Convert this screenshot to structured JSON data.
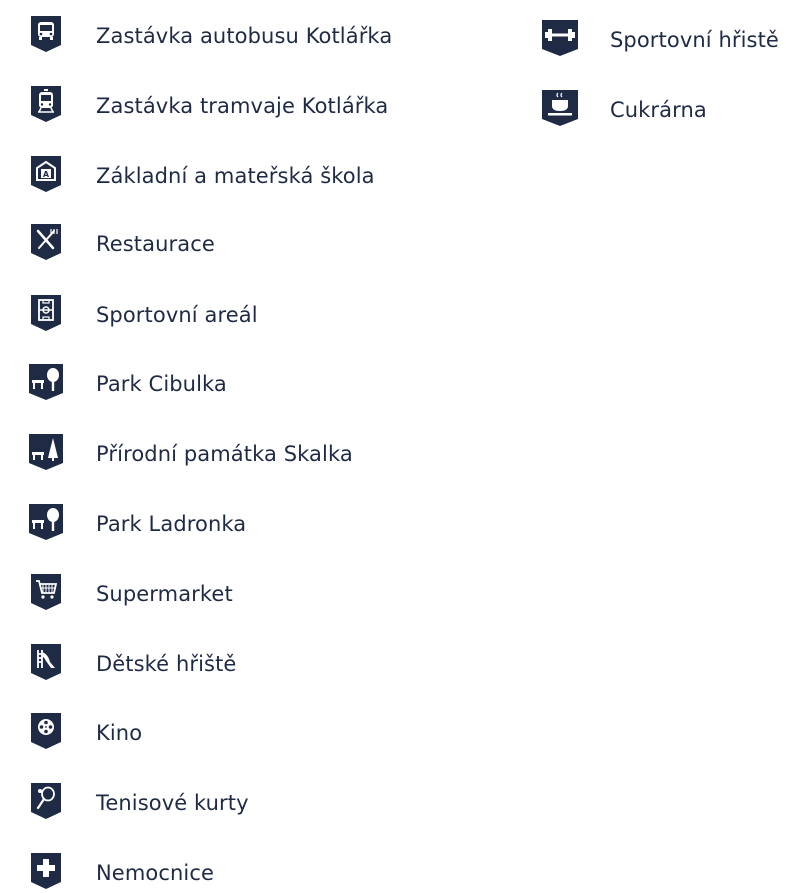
{
  "legend": {
    "left_items": [
      {
        "icon": "bus-icon",
        "label": "Zastávka autobusu Kotlářka"
      },
      {
        "icon": "tram-icon",
        "label": "Zastávka tramvaje Kotlářka"
      },
      {
        "icon": "school-icon",
        "label": "Základní a mateřská škola"
      },
      {
        "icon": "restaurant-icon",
        "label": "Restaurace"
      },
      {
        "icon": "sports-field-icon",
        "label": "Sportovní areál"
      },
      {
        "icon": "park-icon",
        "label": "Park Cibulka"
      },
      {
        "icon": "nature-monument-icon",
        "label": "Přírodní památka Skalka"
      },
      {
        "icon": "park-icon",
        "label": "Park Ladronka"
      },
      {
        "icon": "shopping-cart-icon",
        "label": "Supermarket"
      },
      {
        "icon": "playground-slide-icon",
        "label": "Dětské hřiště"
      },
      {
        "icon": "film-reel-icon",
        "label": "Kino"
      },
      {
        "icon": "tennis-racket-icon",
        "label": "Tenisové kurty"
      },
      {
        "icon": "hospital-cross-icon",
        "label": "Nemocnice"
      }
    ],
    "right_items": [
      {
        "icon": "dumbbell-icon",
        "label": "Sportovní hřistě"
      },
      {
        "icon": "coffee-cup-icon",
        "label": "Cukrárna"
      }
    ]
  },
  "colors": {
    "badge": "#1f2a44",
    "text": "#1f2a44",
    "background": "#ffffff"
  }
}
